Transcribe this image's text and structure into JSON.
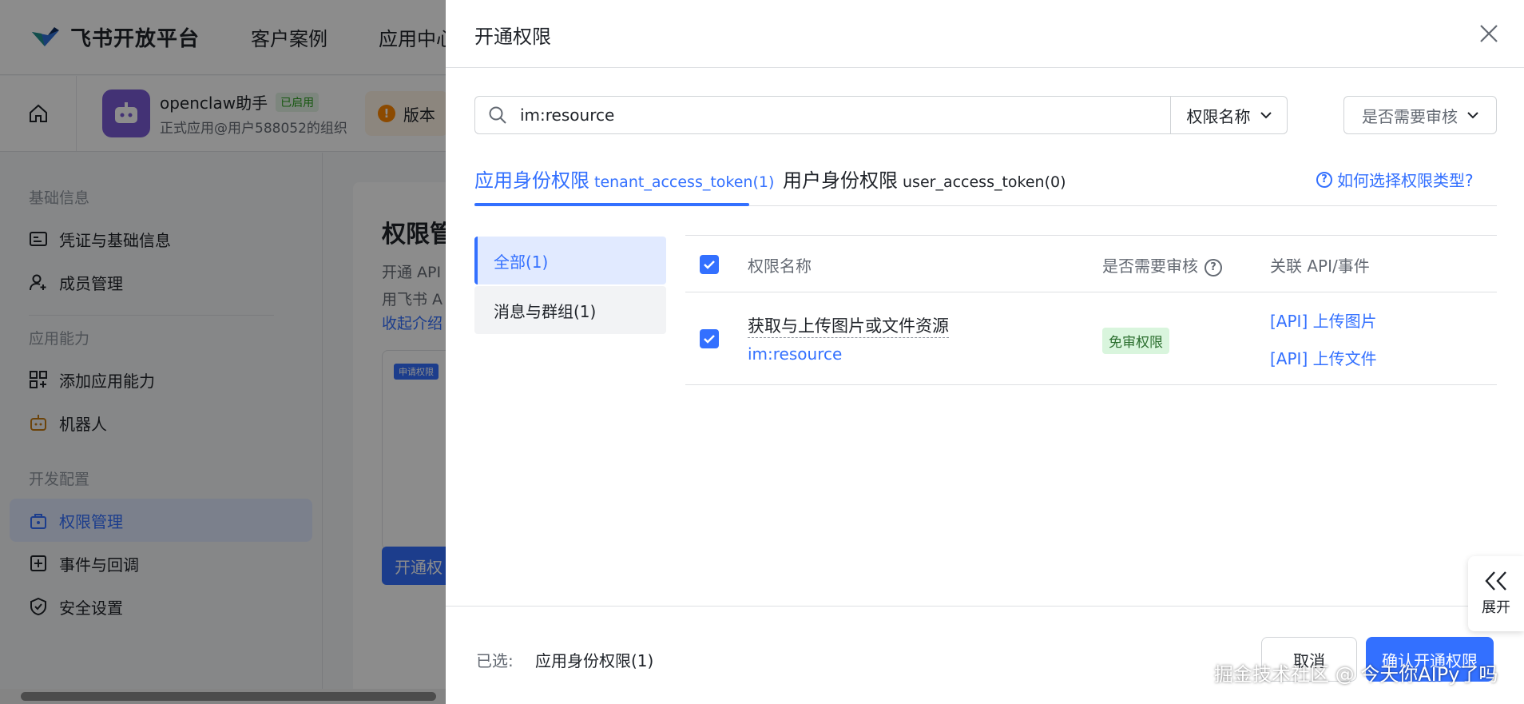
{
  "topnav": {
    "brand": "飞书开放平台",
    "links": [
      "客户案例",
      "应用中心"
    ]
  },
  "appbar": {
    "app_name": "openclaw助手",
    "status_badge": "已启用",
    "app_org": "正式应用@用户588052的组织",
    "version_text": "版本"
  },
  "sidebar": {
    "group_basic": "基础信息",
    "item_credentials": "凭证与基础信息",
    "item_members": "成员管理",
    "group_capability": "应用能力",
    "item_add_capability": "添加应用能力",
    "item_bot": "机器人",
    "group_dev": "开发配置",
    "item_permissions": "权限管理",
    "item_events": "事件与回调",
    "item_security": "安全设置"
  },
  "main": {
    "title": "权限管",
    "desc_line1": "开通 API",
    "desc_line2": "用飞书 A",
    "collapse_link": "收起介绍",
    "mini_tag": "申请权限",
    "open_button": "开通权"
  },
  "drawer": {
    "title": "开通权限",
    "search": {
      "value": "im:resource",
      "field_select": "权限名称",
      "review_filter": "是否需要审核"
    },
    "tabs": [
      {
        "label": "应用身份权限",
        "token": "tenant_access_token(1)",
        "active": true
      },
      {
        "label": "用户身份权限",
        "token": "user_access_token(0)",
        "active": false
      }
    ],
    "help_link": "如何选择权限类型?",
    "categories": [
      {
        "label": "全部(1)",
        "active": true
      },
      {
        "label": "消息与群组(1)",
        "active": false
      }
    ],
    "table": {
      "headers": {
        "name": "权限名称",
        "review": "是否需要审核",
        "api": "关联 API/事件"
      },
      "rows": [
        {
          "checked": true,
          "name": "获取与上传图片或文件资源",
          "key": "im:resource",
          "review_badge": "免审权限",
          "apis": [
            "[API] 上传图片",
            "[API] 上传文件"
          ]
        }
      ]
    },
    "footer": {
      "selected_label": "已选:",
      "selected_value": "应用身份权限(1)",
      "cancel": "取消",
      "confirm": "确认开通权限"
    },
    "expand_label": "展开"
  },
  "watermark": "掘金技术社区 @ 今天你AIPy了吗",
  "colors": {
    "accent": "#3370ff",
    "mask": "rgba(0,0,0,0.45)",
    "free_badge_bg": "#d9f5dd",
    "app_icon_bg": "#7b5cd6"
  }
}
